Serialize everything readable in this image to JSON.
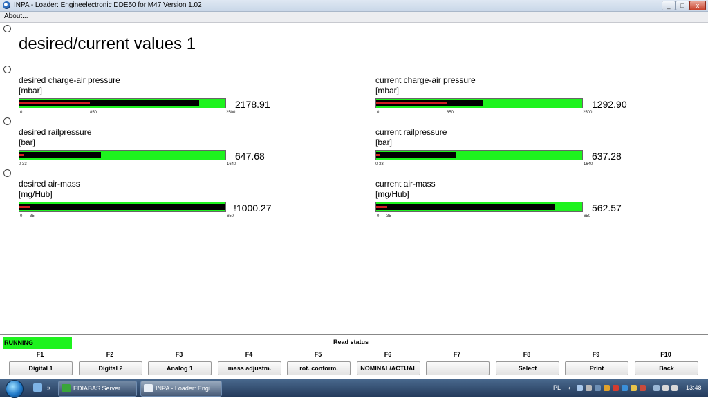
{
  "window": {
    "title": "INPA - Loader:  Engineelectronic DDE50 for M47 Version 1.02",
    "buttons": [
      "_",
      "□",
      "x"
    ]
  },
  "menu": {
    "about": "About..."
  },
  "page": {
    "title": "desired/current values 1"
  },
  "gauges": {
    "desired_charge": {
      "label": "desired charge-air pressure",
      "unit": "[mbar]",
      "min": "0",
      "mark": "850",
      "max": "2500",
      "value": "2178.91",
      "fill": 0.871,
      "red": 0.343
    },
    "current_charge": {
      "label": "current charge-air pressure",
      "unit": "[mbar]",
      "min": "0",
      "mark": "850",
      "max": "2500",
      "value": "1292.90",
      "fill": 0.517,
      "red": 0.343
    },
    "desired_rail": {
      "label": "desired railpressure",
      "unit": "[bar]",
      "min": "0",
      "mark": "33",
      "max": "1640",
      "value": "647.68",
      "fill": 0.395,
      "red": 0.02
    },
    "current_rail": {
      "label": "current railpressure",
      "unit": "[bar]",
      "min": "0",
      "mark": "33",
      "max": "1640",
      "value": "637.28",
      "fill": 0.389,
      "red": 0.02
    },
    "desired_air": {
      "label": "desired air-mass",
      "unit": "[mg/Hub]",
      "min": "0",
      "mark": "35",
      "max": "650",
      "value": "!1000.27",
      "fill": 1.0,
      "red": 0.054
    },
    "current_air": {
      "label": "current air-mass",
      "unit": "[mg/Hub]",
      "min": "0",
      "mark": "35",
      "max": "650",
      "value": "562.57",
      "fill": 0.865,
      "red": 0.054
    }
  },
  "status": {
    "running": "RUNNING",
    "read_status": "Read status"
  },
  "function_keys": [
    {
      "key": "F1",
      "label": "Digital 1"
    },
    {
      "key": "F2",
      "label": "Digital 2"
    },
    {
      "key": "F3",
      "label": "Analog 1"
    },
    {
      "key": "F4",
      "label": "mass adjustm."
    },
    {
      "key": "F5",
      "label": "rot. conform."
    },
    {
      "key": "F6",
      "label": "NOMINAL/ACTUAL"
    },
    {
      "key": "F7",
      "label": ""
    },
    {
      "key": "F8",
      "label": "Select"
    },
    {
      "key": "F9",
      "label": "Print"
    },
    {
      "key": "F10",
      "label": "Back"
    }
  ],
  "taskbar": {
    "quicklaunch": "»",
    "tasks": [
      "EDIABAS Server",
      "INPA - Loader:  Engi..."
    ],
    "lang": "PL",
    "tray_chevron": "‹",
    "time": "13:48"
  }
}
